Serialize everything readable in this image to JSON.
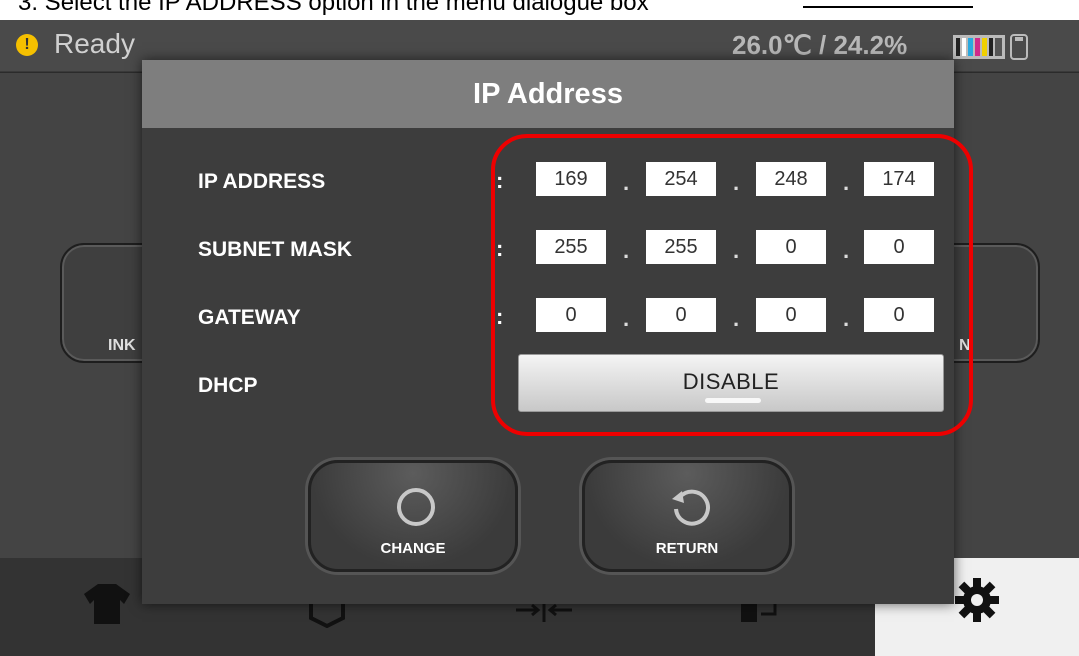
{
  "instruction": {
    "text": "3. Select the IP ADDRESS option in the menu dialogue box"
  },
  "status": {
    "state": "Ready",
    "temperature_humidity": "26.0℃ / 24.2%"
  },
  "background": {
    "left_button": "INK",
    "right_button": "N"
  },
  "dialog": {
    "title": "IP Address",
    "rows": [
      {
        "label": "IP ADDRESS",
        "octets": [
          "169",
          "254",
          "248",
          "174"
        ]
      },
      {
        "label": "SUBNET MASK",
        "octets": [
          "255",
          "255",
          "0",
          "0"
        ]
      },
      {
        "label": "GATEWAY",
        "octets": [
          "0",
          "0",
          "0",
          "0"
        ]
      }
    ],
    "dhcp": {
      "label": "DHCP",
      "value": "DISABLE"
    },
    "colon": ":",
    "dot": ".",
    "buttons": {
      "change": "CHANGE",
      "return": "RETURN"
    }
  },
  "tabs": [
    "tshirt-icon",
    "maintenance-icon",
    "align-icon",
    "transfer-icon",
    "gear-icon"
  ],
  "colors": {
    "highlight": "#ee0000",
    "status_warning": "#f5c000",
    "ink_cyan": "#2aa9e0",
    "ink_magenta": "#d02a8a",
    "ink_yellow": "#f0d000"
  }
}
